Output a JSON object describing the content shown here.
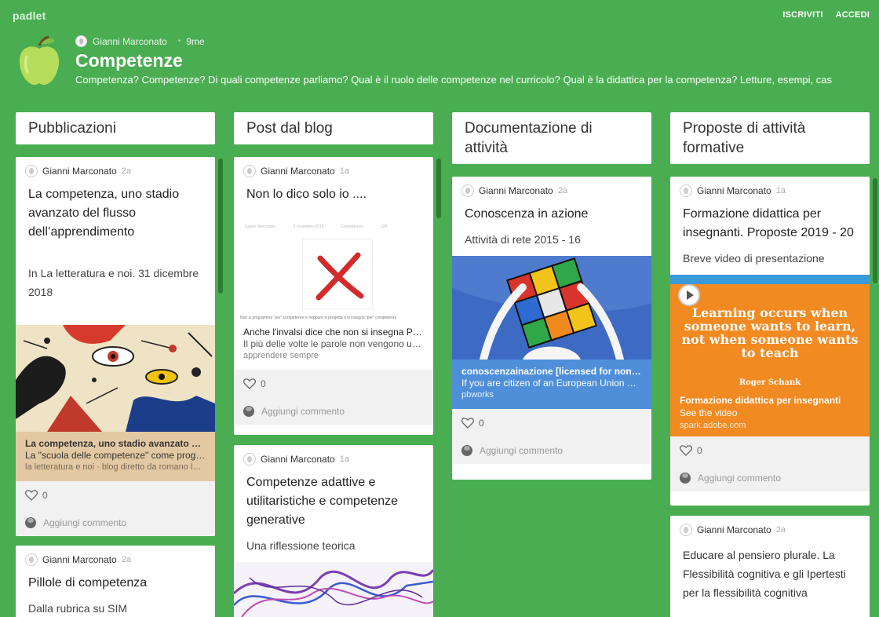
{
  "topbar": {
    "logo": "padlet",
    "signup": "ISCRIVITI",
    "login": "ACCEDI"
  },
  "board": {
    "author": "Gianni Marconato",
    "age": "9me",
    "title": "Competenze",
    "description": "Competenza? Competenze? Di quali competenze parliamo? Qual è il ruolo delle competenze nel curricolo? Qual è la didattica per la competenza? Letture, esempi, cas"
  },
  "columns": [
    {
      "title": "Pubblicazioni"
    },
    {
      "title": "Post dal blog"
    },
    {
      "title": "Documentazione di attività"
    },
    {
      "title": "Proposte di attività formative"
    }
  ],
  "posts": {
    "p1": {
      "author": "Gianni Marconato",
      "ago": "2a",
      "title": "La competenza, uno stadio avanzato del flusso dell’apprendimento",
      "body": "In La letteratura e noi. 31 dicembre 2018",
      "link_title": "La competenza, uno stadio avanzato del…",
      "link_desc": "La \"scuola delle competenze\" come prog…",
      "link_source": "la letteratura e noi · blog diretto da romano lu…",
      "likes": "0",
      "comment": "Aggiungi commento"
    },
    "p2": {
      "author": "Gianni Marconato",
      "ago": "2a",
      "title": "Pillole di competenza",
      "body": "Dalla rubrica su SIM"
    },
    "p3": {
      "author": "Gianni Marconato",
      "ago": "1a",
      "title": "Non lo dico solo io ....",
      "link_title": "Anche l'invalsi dice che non si insegna P…",
      "link_desc": "Il più delle volte le parole non vengono u…",
      "link_source": "apprendere sempre",
      "likes": "0",
      "comment": "Aggiungi commento",
      "thumb_caption": "Non si programma \"per\" competenze e neppure si progetta o si insegna \"per\" competenze",
      "thumb_crumbs": [
        "Gianni Marconato",
        "9 novembre 2018",
        "Competenze",
        "128"
      ]
    },
    "p4": {
      "author": "Gianni Marconato",
      "ago": "1a",
      "title": "Competenze adattive e utilitaristiche e competenze generative",
      "body": "Una riflessione teorica"
    },
    "p5": {
      "author": "Gianni Marconato",
      "ago": "2a",
      "title": "Conoscenza in azione",
      "body": "Attività di rete 2015 - 16",
      "link_title": "conoscenzainazione [licensed for non-c…",
      "link_desc": "If you are citizen of an European Union m…",
      "link_source": "pbworks",
      "likes": "0",
      "comment": "Aggiungi commento"
    },
    "p6": {
      "author": "Gianni Marconato",
      "ago": "1a",
      "title": "Formazione didattica per insegnanti. Proposte 2019 - 20",
      "body": "Breve video di presentazione",
      "quote": "Learning occurs when someone wants to learn, not when someone wants to teach",
      "quote_author": "Roger Schank",
      "link_title": "Formazione didattica per insegnanti",
      "link_desc": "See the video",
      "link_source": "spark.adobe.com",
      "likes": "0",
      "comment": "Aggiungi commento"
    },
    "p7": {
      "author": "Gianni Marconato",
      "ago": "2a",
      "title": "Educare al pensiero plurale. La Flessibilità cognitiva e gli Ipertesti per la flessibilità cognitiva"
    }
  },
  "colors": {
    "background": "#4aad52",
    "link_blue": "#4f8fd9",
    "link_orange": "#f28a22",
    "link_beige": "#e3c9a3"
  }
}
